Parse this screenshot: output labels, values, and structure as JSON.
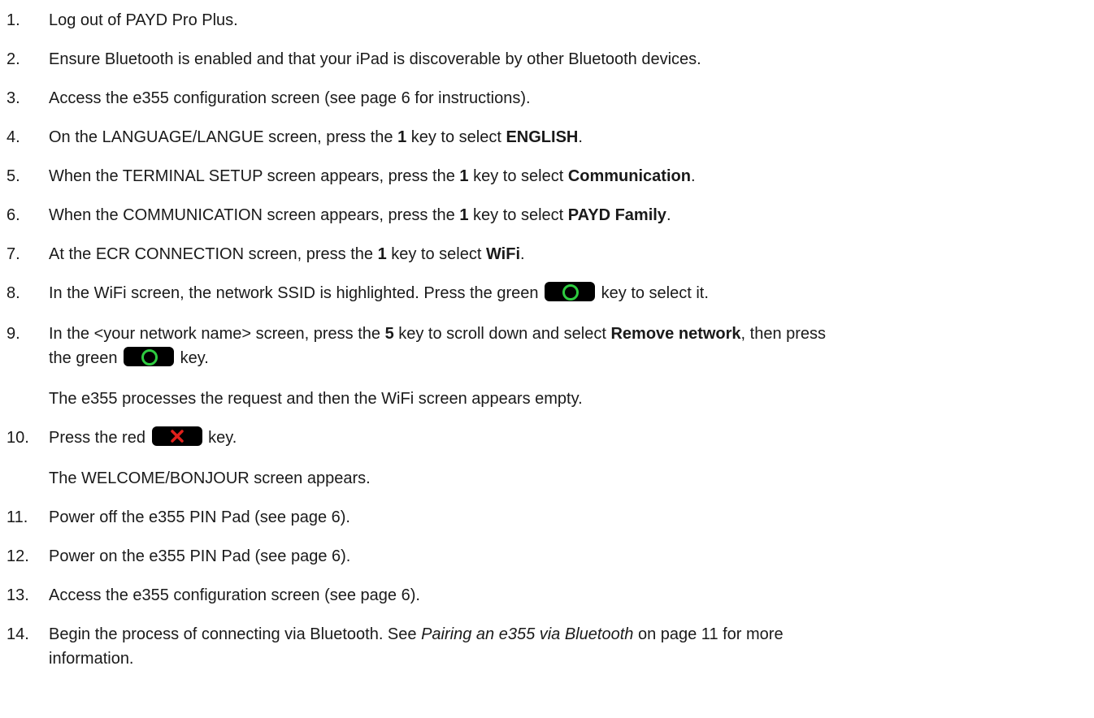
{
  "steps": [
    {
      "num": "1.",
      "parts": [
        "Log out of PAYD Pro Plus."
      ]
    },
    {
      "num": "2.",
      "parts": [
        "Ensure Bluetooth is enabled and that your iPad is discoverable by other Bluetooth devices."
      ]
    },
    {
      "num": "3.",
      "parts": [
        "Access the e355 configuration screen (see page 6 for instructions)."
      ]
    },
    {
      "num": "4.",
      "parts": [
        "On the LANGUAGE/LANGUE screen, press the ",
        "1",
        " key to select ",
        "ENGLISH",
        "."
      ]
    },
    {
      "num": "5.",
      "parts": [
        "When the TERMINAL SETUP screen appears, press the ",
        "1",
        " key to select ",
        "Communication",
        "."
      ]
    },
    {
      "num": "6.",
      "parts": [
        "When the COMMUNICATION screen appears, press the ",
        "1",
        " key to select ",
        "PAYD Family",
        "."
      ]
    },
    {
      "num": "7.",
      "parts": [
        "At the ECR CONNECTION screen, press the ",
        "1",
        " key to select ",
        "WiFi",
        "."
      ]
    },
    {
      "num": "8.",
      "parts": [
        "In the WiFi screen, the network SSID is highlighted. Press the green ",
        " key to select it."
      ]
    },
    {
      "num": "9.",
      "parts": [
        "In the <your network name> screen, press the ",
        "5",
        " key to scroll down and select ",
        "Remove network",
        ", then press",
        "the green ",
        " key."
      ]
    },
    {
      "num": "10.",
      "parts": [
        "Press the red ",
        " key."
      ]
    },
    {
      "num": "11.",
      "parts": [
        "Power off the e355 PIN Pad (see page 6)."
      ]
    },
    {
      "num": "12.",
      "parts": [
        "Power on the e355 PIN Pad (see page 6)."
      ]
    },
    {
      "num": "13.",
      "parts": [
        "Access the e355 configuration screen (see page 6)."
      ]
    },
    {
      "num": "14.",
      "parts": [
        "Begin the process of connecting via Bluetooth. See ",
        "Pairing an e355 via Bluetooth",
        " on page 11 for more",
        "information."
      ]
    }
  ],
  "notes": {
    "after_9": "The e355 processes the request and then the WiFi screen appears empty.",
    "after_10": "The WELCOME/BONJOUR screen appears."
  },
  "icons": {
    "green_key": "green-enter-key-icon",
    "red_key": "red-cancel-key-icon"
  },
  "colors": {
    "green_key_ring": "#2ecc40",
    "red_key_x": "#e0201c",
    "key_body": "#000000"
  }
}
